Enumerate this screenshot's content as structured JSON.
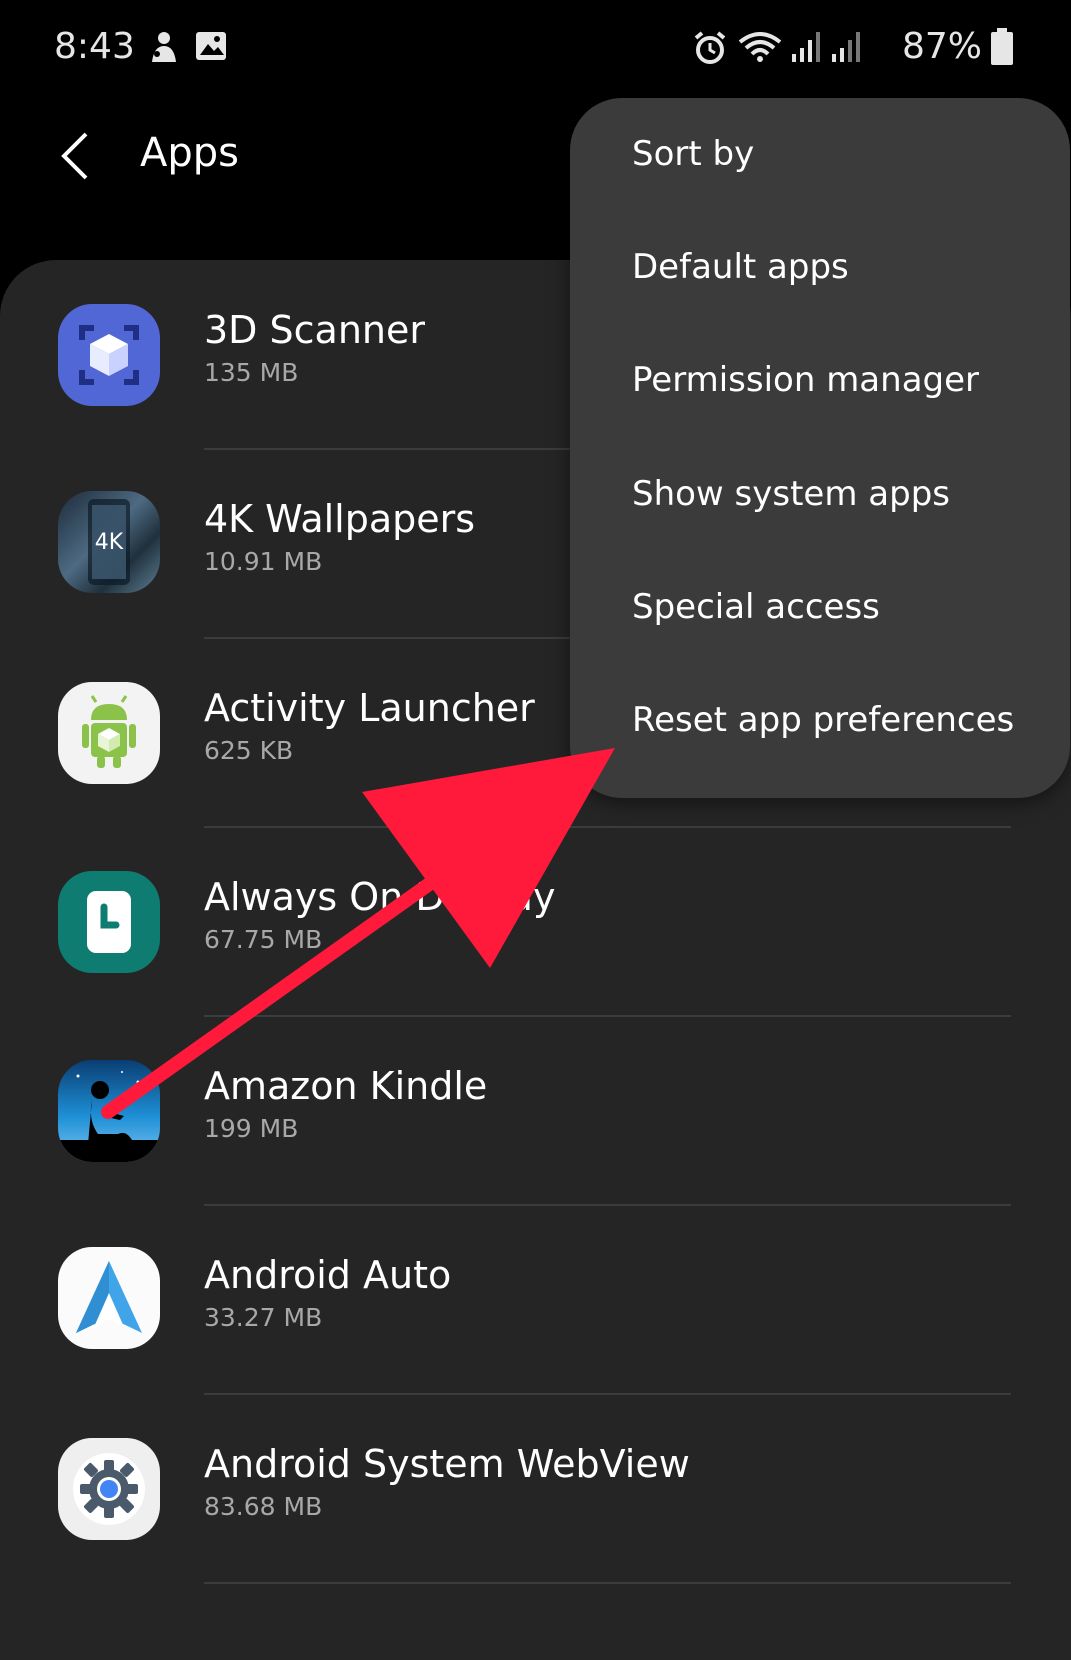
{
  "status_bar": {
    "time": "8:43",
    "battery": "87%",
    "icons": [
      "notification-icon",
      "image-icon",
      "alarm-icon",
      "wifi-icon",
      "signal-icon",
      "signal-icon",
      "battery-icon"
    ]
  },
  "app_bar": {
    "title": "Apps",
    "back_icon": "chevron-left-icon"
  },
  "apps": [
    {
      "name": "3D Scanner",
      "size": "135 MB",
      "icon": "3d-scanner-icon"
    },
    {
      "name": "4K Wallpapers",
      "size": "10.91 MB",
      "icon": "4k-wallpapers-icon"
    },
    {
      "name": "Activity Launcher",
      "size": "625 KB",
      "icon": "activity-launcher-icon"
    },
    {
      "name": "Always On Display",
      "size": "67.75 MB",
      "icon": "always-on-display-icon"
    },
    {
      "name": "Amazon Kindle",
      "size": "199 MB",
      "icon": "amazon-kindle-icon"
    },
    {
      "name": "Android Auto",
      "size": "33.27 MB",
      "icon": "android-auto-icon"
    },
    {
      "name": "Android System WebView",
      "size": "83.68 MB",
      "icon": "android-system-webview-icon"
    }
  ],
  "overflow_menu": {
    "items": [
      "Sort by",
      "Default apps",
      "Permission manager",
      "Show system apps",
      "Special access",
      "Reset app preferences"
    ]
  },
  "annotation": {
    "arrow_color": "#ff1a3c",
    "target": "Reset app preferences"
  },
  "colors": {
    "background": "#000000",
    "list_background": "#252525",
    "menu_background": "#3b3b3b",
    "secondary_text": "#a8a8a8"
  }
}
